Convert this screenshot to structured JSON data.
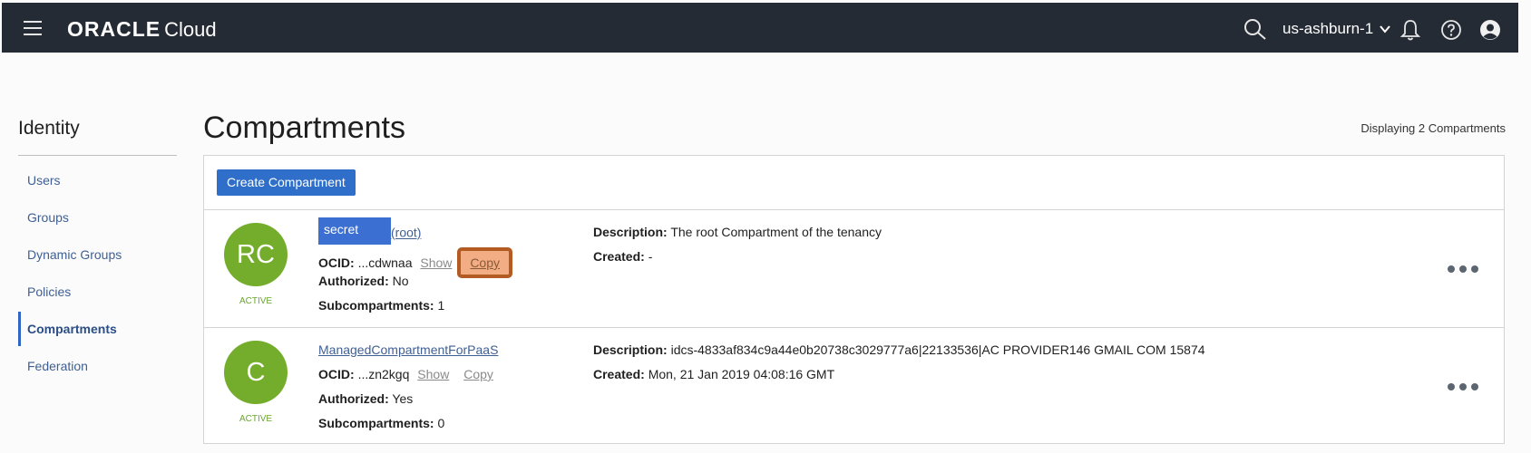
{
  "header": {
    "brand_main": "ORACLE",
    "brand_sub": "Cloud",
    "region": "us-ashburn-1"
  },
  "sidebar": {
    "title": "Identity",
    "items": [
      {
        "label": "Users"
      },
      {
        "label": "Groups"
      },
      {
        "label": "Dynamic Groups"
      },
      {
        "label": "Policies"
      },
      {
        "label": "Compartments",
        "active": true
      },
      {
        "label": "Federation"
      }
    ]
  },
  "main": {
    "title": "Compartments",
    "count_text": "Displaying 2 Compartments",
    "create_button": "Create Compartment",
    "labels": {
      "ocid": "OCID:",
      "authorized": "Authorized:",
      "subcompartments": "Subcompartments:",
      "description": "Description:",
      "created": "Created:",
      "show": "Show",
      "copy": "Copy"
    },
    "rows": [
      {
        "initials": "RC",
        "status": "ACTIVE",
        "name_redacted": "secret",
        "name_suffix": "(root)",
        "ocid": "...cdwnaa",
        "authorized": "No",
        "subcompartments": "1",
        "description": "The root Compartment of the tenancy",
        "created": "-"
      },
      {
        "initials": "C",
        "status": "ACTIVE",
        "name": "ManagedCompartmentForPaaS",
        "ocid": "...zn2kgq",
        "authorized": "Yes",
        "subcompartments": "0",
        "description": "idcs-4833af834c9a44e0b20738c3029777a6|22133536|AC PROVIDER146 GMAIL COM 15874",
        "created": "Mon, 21 Jan 2019 04:08:16 GMT"
      }
    ]
  },
  "colors": {
    "header_bg": "#252b35",
    "accent": "#2f6fc9",
    "avatar": "#74ad2b",
    "highlight": "#f2ad84"
  }
}
